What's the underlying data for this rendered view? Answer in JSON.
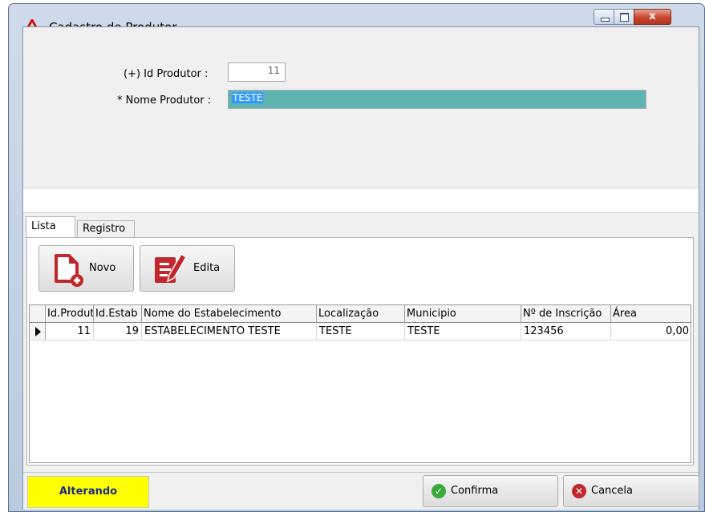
{
  "window": {
    "title": "Cadastro de Produtor",
    "controls": {
      "close_glyph": "x"
    }
  },
  "form": {
    "id_label": "(+) Id Produtor :",
    "id_value": "11",
    "name_label": "* Nome Produtor :",
    "name_value": "TESTE"
  },
  "tabs": [
    {
      "label": "Lista",
      "active": true
    },
    {
      "label": "Registro",
      "active": false
    }
  ],
  "toolbar": {
    "novo_label": "Novo",
    "edita_label": "Edita"
  },
  "grid": {
    "columns": [
      "Id.Produtor",
      "Id.Estab",
      "Nome do Estabelecimento",
      "Localização",
      "Municipio",
      "Nº de Inscrição",
      "Área"
    ],
    "rows": [
      [
        "11",
        "19",
        "ESTABELECIMENTO TESTE",
        "TESTE",
        "TESTE",
        "123456",
        "0,00"
      ]
    ]
  },
  "status": {
    "mode": "Alterando",
    "confirm_label": "Confirma",
    "cancel_label": "Cancela"
  },
  "colors": {
    "name_field_bg": "#5fb3b0",
    "mode_bg": "#ffff00",
    "mode_text": "#1a2a8a",
    "icon_red": "#c0282d",
    "confirm_green": "#3aa83a"
  }
}
